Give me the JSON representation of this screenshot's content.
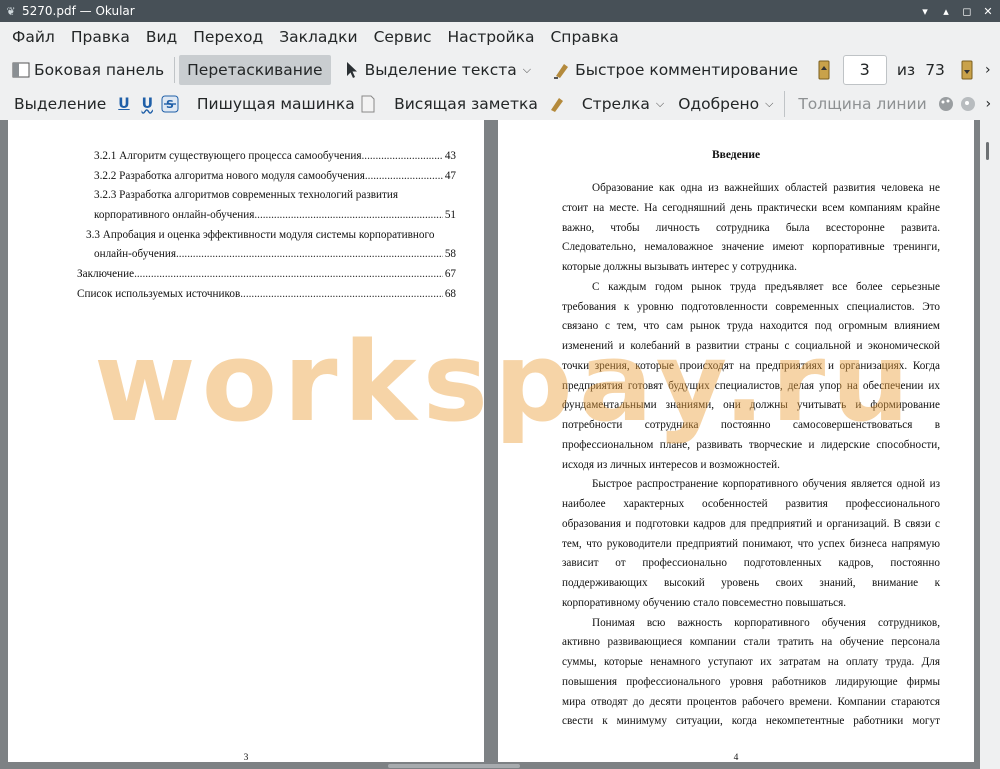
{
  "window": {
    "title": "5270.pdf  — Okular"
  },
  "menu": [
    "Файл",
    "Правка",
    "Вид",
    "Переход",
    "Закладки",
    "Сервис",
    "Настройка",
    "Справка"
  ],
  "toolbar1": {
    "sidebar": "Боковая панель",
    "drag": "Перетаскивание",
    "text_select": "Выделение текста",
    "quick_annot": "Быстрое комментирование",
    "page_current": "3",
    "of": "из",
    "page_total": "73"
  },
  "toolbar2": {
    "selection": "Выделение",
    "typewriter": "Пишущая машинка",
    "sticky_note": "Висящая заметка",
    "arrow": "Стрелка",
    "approved": "Одобрено",
    "line_width": "Толщина линии"
  },
  "left_page": {
    "toc": [
      {
        "label": "3.2.1 Алгоритм существующего процесса самообучения",
        "page": "43"
      },
      {
        "label": "3.2.2 Разработка алгоритма нового модуля самообучения",
        "page": "47"
      },
      {
        "label_line1": "3.2.3   Разработка   алгоритмов   современных   технологий   развития",
        "label": "корпоративного онлайн-обучения",
        "page": "51"
      },
      {
        "label_line1": "3.3 Апробация и оценка эффективности модуля системы корпоративного",
        "label": "онлайн-обучения",
        "page": "58"
      },
      {
        "label": "Заключение",
        "page": "67"
      },
      {
        "label": "Список используемых источников",
        "page": "68"
      }
    ],
    "page_number": "3"
  },
  "right_page": {
    "heading": "Введение",
    "lines": [
      "Образование как одна из важнейших областей развития человека не",
      "стоит на месте. На сегодняшний день практически всем компаниям крайне",
      "важно, чтобы личность сотрудника была всесторонне развита.",
      "Следовательно, немаловажное значение имеют корпоративные тренинги,",
      "которые должны вызывать интерес у сотрудника.",
      "С каждым годом рынок труда предъявляет все более серьезные",
      "требования к уровню подготовленности современных специалистов. Это",
      "связано с тем, что сам рынок труда находится под огромным влиянием",
      "изменений и колебаний в развитии страны с социальной и экономической",
      "точки зрения, которые происходят на предприятиях и организациях. Когда",
      "предприятия готовят будущих специалистов, делая упор на обеспечении их",
      "фундаментальными знаниями, они должны учитывать и формирование",
      "потребности сотрудника постоянно самосовершенствоваться в",
      "профессиональном плане, развивать творческие и лидерские способности,",
      "исходя из личных интересов и возможностей.",
      "Быстрое распространение корпоративного обучения является одной из",
      "наиболее характерных особенностей развития профессионального",
      "образования и подготовки кадров для предприятий и организаций. В связи с",
      "тем, что руководители предприятий понимают, что успех бизнеса напрямую",
      "зависит от профессионально подготовленных кадров, постоянно",
      "поддерживающих высокий уровень своих знаний, внимание к",
      "корпоративному обучению стало повсеместно повышаться.",
      "Понимая всю важность корпоративного обучения сотрудников,",
      "активно развивающиеся компании стали тратить на обучение персонала",
      "суммы, которые ненамного уступают их затратам на оплату труда. Для",
      "повышения профессионального уровня работников лидирующие фирмы",
      "мира отводят до десяти процентов рабочего времени. Компании стараются",
      "свести к минимуму ситуации, когда некомпетентные работники могут"
    ],
    "page_number": "4"
  },
  "watermark": "workspay.ru",
  "colors": {
    "titlebar": "#475057",
    "viewer_bg": "#7d8184",
    "watermark": "#eaa03c"
  }
}
